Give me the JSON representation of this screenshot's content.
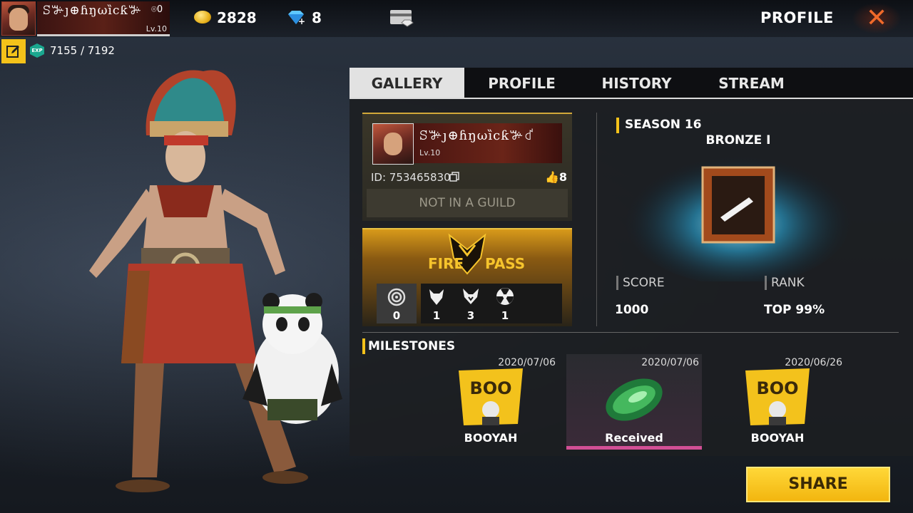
{
  "header": {
    "player_name": "ꕶꔑȷ⊕ɦŋωȉcƙꔑ",
    "badge_count": "0",
    "level": "Lv.10",
    "coins": "2828",
    "diamonds": "8",
    "title": "PROFILE",
    "close_label": "✕"
  },
  "exp": {
    "icon_text": "EXP",
    "value": "7155 / 7192"
  },
  "tabs": [
    {
      "label": "GALLERY",
      "active": true
    },
    {
      "label": "PROFILE",
      "active": false
    },
    {
      "label": "HISTORY",
      "active": false
    },
    {
      "label": "STREAM",
      "active": false
    }
  ],
  "player_card": {
    "name": "ꕶꔑȷ⊕ɦŋωȉcƙꔑ꒮",
    "level": "Lv.10",
    "id_text": "ID: 753465830",
    "likes": "8",
    "guild": "NOT IN A GUILD"
  },
  "fire_pass": {
    "word1": "FIRE",
    "word2": "PASS",
    "badge_count": "0",
    "tokens": [
      {
        "icon": "wolf-icon",
        "value": "1"
      },
      {
        "icon": "fox-icon",
        "value": "3"
      },
      {
        "icon": "radiation-icon",
        "value": "1"
      }
    ]
  },
  "season": {
    "label": "SEASON 16",
    "rank_name": "BRONZE I",
    "score_label": "SCORE",
    "score_value": "1000",
    "rank_label": "RANK",
    "rank_value": "TOP 99%"
  },
  "milestones": {
    "title": "MILESTONES",
    "items": [
      {
        "date": "2020/07/06",
        "label": "BOOYAH",
        "icon": "booyah-icon"
      },
      {
        "date": "2020/07/06",
        "label": "Received",
        "icon": "parachute-icon"
      },
      {
        "date": "2020/06/26",
        "label": "BOOYAH",
        "icon": "booyah-icon"
      }
    ]
  },
  "share_label": "SHARE",
  "colors": {
    "accent": "#f4c21a",
    "close": "#f06a2a",
    "highlight": "#d24f95"
  }
}
